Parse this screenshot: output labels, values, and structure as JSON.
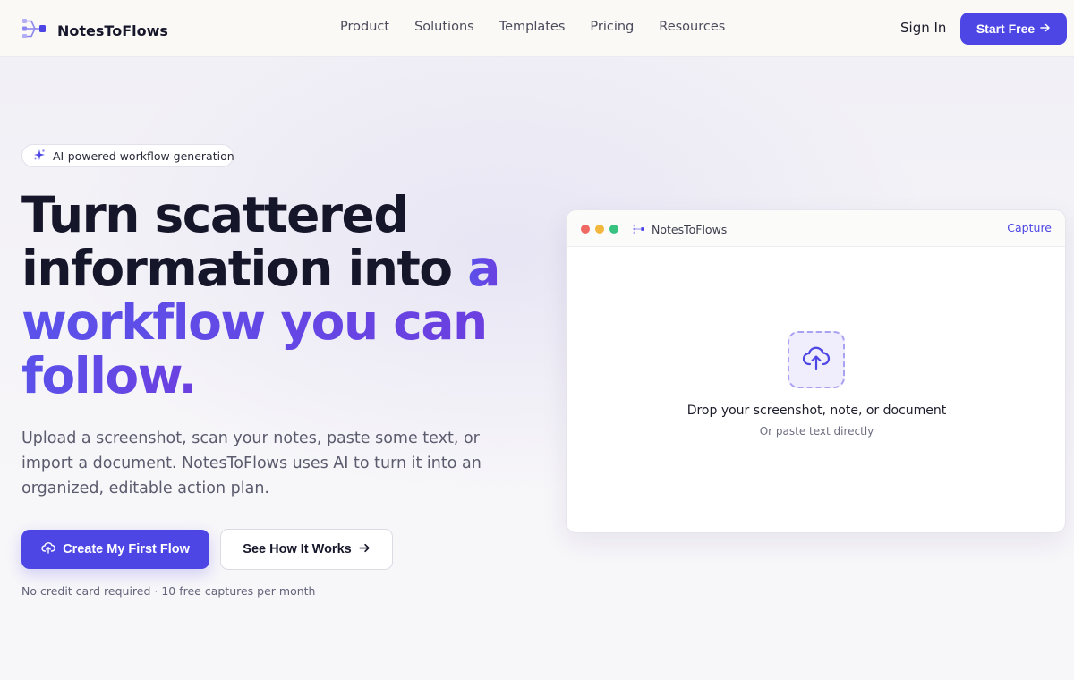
{
  "brand": {
    "name": "NotesToFlows",
    "logo_icon": "flow-logo-icon",
    "accent": "#4d46e5"
  },
  "nav": {
    "links": [
      "Product",
      "Solutions",
      "Templates",
      "Pricing",
      "Resources"
    ],
    "sign_in": "Sign In",
    "start_free": "Start Free"
  },
  "hero": {
    "badge": "AI-powered workflow generation",
    "headline_line1": "Turn scattered",
    "headline_line2_plain": "information into ",
    "headline_line2_accent": "a",
    "headline_line3": "workflow you can",
    "headline_line4": "follow.",
    "subtext": "Upload a screenshot, scan your notes, paste some text, or import a document. NotesToFlows uses AI to turn it into an organized, editable action plan.",
    "cta_primary": "Create My First Flow",
    "cta_secondary": "See How It Works",
    "fine_print": "No credit card required · 10 free captures per month"
  },
  "app_window": {
    "title": "NotesToFlows",
    "action": "Capture",
    "drop_title": "Drop your screenshot, note, or document",
    "drop_subtitle": "Or paste text directly"
  }
}
